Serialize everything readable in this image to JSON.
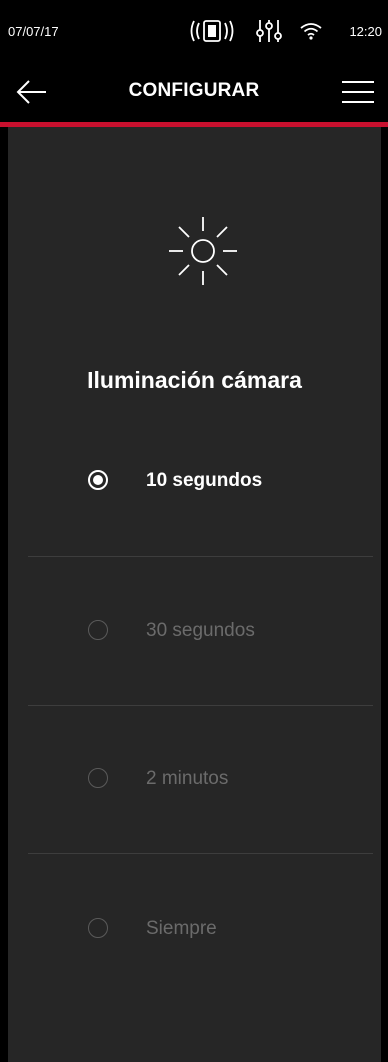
{
  "status_bar": {
    "date": "07/07/17",
    "time": "12:20",
    "icons": [
      "vibrate-icon",
      "equalizer-icon",
      "wifi-icon"
    ]
  },
  "header": {
    "title": "CONFIGURAR",
    "back_icon": "arrow-left-icon",
    "menu_icon": "hamburger-menu-icon"
  },
  "colors": {
    "accent": "#c8102e",
    "background": "#262626",
    "header": "#000000"
  },
  "section": {
    "icon": "sun-icon",
    "title": "Iluminación cámara"
  },
  "options": [
    {
      "label": "10 segundos",
      "selected": true
    },
    {
      "label": "30 segundos",
      "selected": false
    },
    {
      "label": "2 minutos",
      "selected": false
    },
    {
      "label": "Siempre",
      "selected": false
    }
  ]
}
